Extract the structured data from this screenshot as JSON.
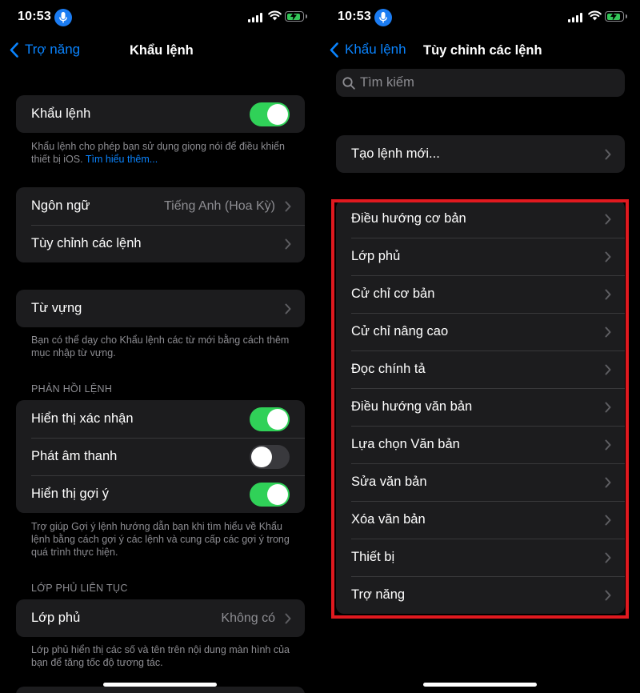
{
  "status": {
    "time": "10:53",
    "colors": {
      "mic_pill": "#1b7cf2",
      "battery": "#34c759"
    }
  },
  "left": {
    "nav": {
      "back_label": "Trợ năng",
      "title": "Khẩu lệnh"
    },
    "voice_control": {
      "label": "Khẩu lệnh",
      "enabled": true,
      "footer_text": "Khẩu lệnh cho phép bạn sử dụng giọng nói để điều khiển thiết bị iOS.",
      "footer_link": "Tìm hiểu thêm..."
    },
    "language": {
      "label": "Ngôn ngữ",
      "value": "Tiếng Anh (Hoa Kỳ)"
    },
    "customize": {
      "label": "Tùy chỉnh các lệnh"
    },
    "vocabulary": {
      "label": "Từ vựng",
      "footer": "Bạn có thể dạy cho Khẩu lệnh các từ mới bằng cách thêm mục nhập từ vựng."
    },
    "feedback": {
      "header": "PHẢN HỒI LỆNH",
      "items": [
        {
          "label": "Hiển thị xác nhận",
          "enabled": true
        },
        {
          "label": "Phát âm thanh",
          "enabled": false
        },
        {
          "label": "Hiển thị gợi ý",
          "enabled": true
        }
      ],
      "footer": "Trợ giúp Gợi ý lệnh hướng dẫn bạn khi tìm hiểu về Khẩu lệnh bằng cách gợi ý các lệnh và cung cấp các gợi ý trong quá trình thực hiện."
    },
    "overlay": {
      "header": "LỚP PHỦ LIÊN TỤC",
      "label": "Lớp phủ",
      "value": "Không có",
      "footer": "Lớp phủ hiển thị các số và tên trên nội dung màn hình của bạn để tăng tốc độ tương tác."
    }
  },
  "right": {
    "nav": {
      "back_label": "Khẩu lệnh",
      "title": "Tùy chỉnh các lệnh"
    },
    "search": {
      "placeholder": "Tìm kiếm"
    },
    "new_command": {
      "label": "Tạo lệnh mới..."
    },
    "categories": [
      "Điều hướng cơ bản",
      "Lớp phủ",
      "Cử chỉ cơ bản",
      "Cử chỉ nâng cao",
      "Đọc chính tả",
      "Điều hướng văn bản",
      "Lựa chọn Văn bản",
      "Sửa văn bản",
      "Xóa văn bản",
      "Thiết bị",
      "Trợ năng"
    ],
    "highlight_color": "#e0191f"
  }
}
